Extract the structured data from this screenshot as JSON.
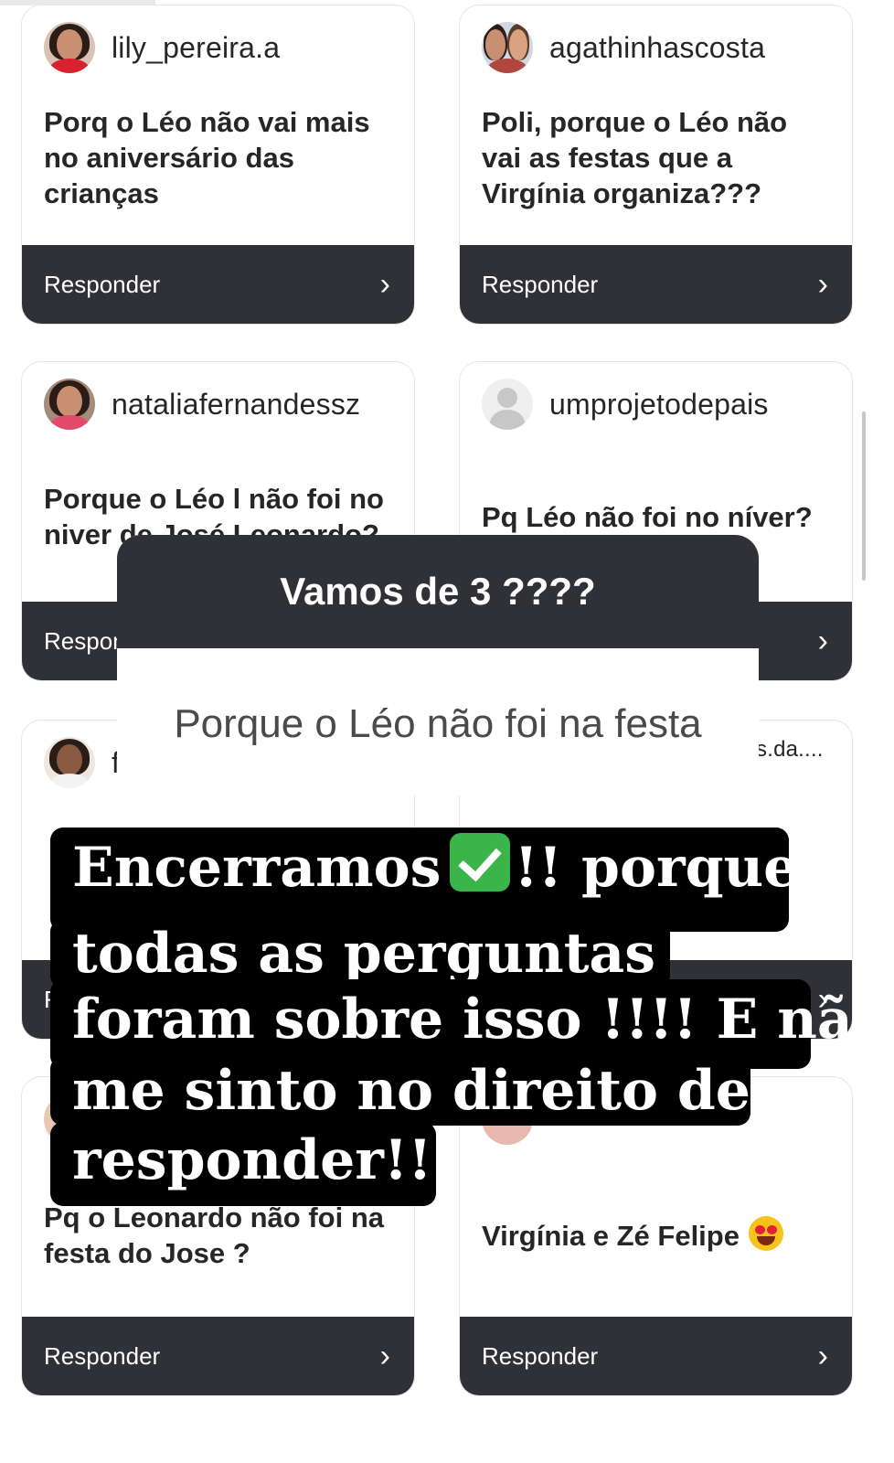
{
  "reply_label": "Responder",
  "cards": [
    {
      "username": "lily_pereira.a",
      "question": "Porq o Léo não vai mais no aniversário das crianças"
    },
    {
      "username": "agathinhascosta",
      "question": "Poli, porque o Léo não vai as festas que a Virgínia organiza???"
    },
    {
      "username": "nataliafernandessz",
      "question": "Porque o Léo l não foi no niver de José Leonardo?"
    },
    {
      "username": "umprojetodepais",
      "question": "Pq Léo não foi no níver?"
    },
    {
      "username": "f",
      "question": ""
    },
    {
      "username": "s.da....",
      "question": ""
    },
    {
      "username": "",
      "question": "Pq o Leonardo não foi na festa do Jose ?"
    },
    {
      "username": "",
      "question": "Virgínia e Zé Felipe"
    }
  ],
  "prompt": {
    "title": "Vamos de 3 ????",
    "answer": "Porque o Léo não foi na festa"
  },
  "overlay": {
    "line1a": "Encerramos",
    "line1b": "!!   porque",
    "line2": "todas as perguntas",
    "line3": "foram sobre isso !!!! E não",
    "line4": "me sinto no direito de",
    "line5": "responder!!!!"
  },
  "icons": {
    "avatar_placeholder": "person-silhouette-icon",
    "chevron": "chevron-right-icon",
    "check_emoji": "check-mark-button-emoji",
    "heart_eyes_emoji": "heart-eyes-emoji"
  },
  "colors": {
    "reply_bar": "#2f3136",
    "overlay_bg": "#000000",
    "check_green": "#3bb54a"
  }
}
